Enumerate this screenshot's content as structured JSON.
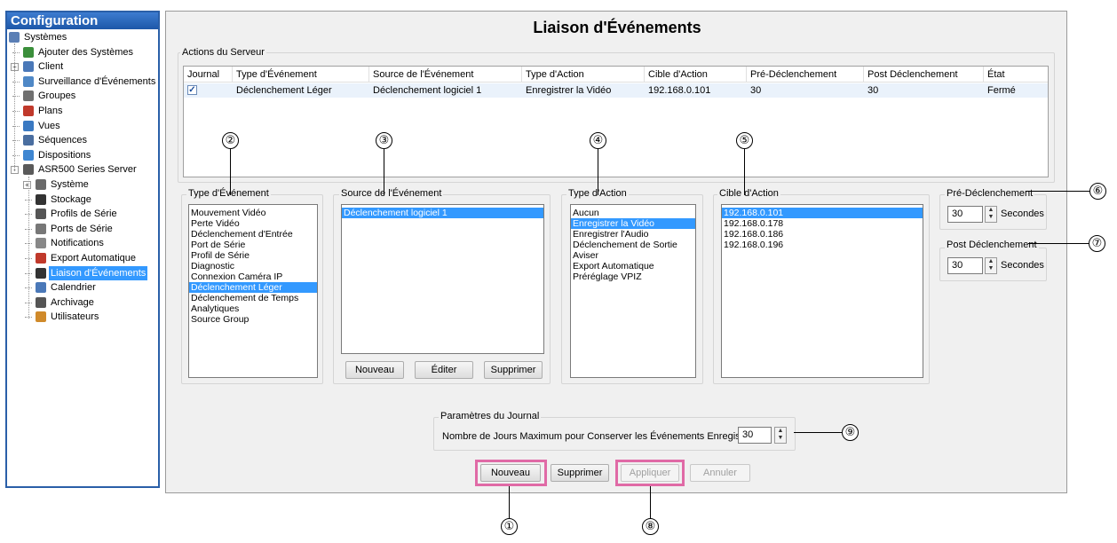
{
  "sidebar": {
    "title": "Configuration",
    "items": [
      {
        "label": "Systèmes",
        "icon": "systems-icon",
        "color": "#5b7fb5"
      },
      {
        "label": "Ajouter des Systèmes",
        "icon": "add-system-icon",
        "color": "#3b8f3b"
      },
      {
        "label": "Client",
        "icon": "client-icon",
        "color": "#4a78b8"
      },
      {
        "label": "Surveillance d'Événements",
        "icon": "event-monitor-icon",
        "color": "#4f88c6"
      },
      {
        "label": "Groupes",
        "icon": "groups-icon",
        "color": "#707070"
      },
      {
        "label": "Plans",
        "icon": "plans-icon",
        "color": "#c0392b"
      },
      {
        "label": "Vues",
        "icon": "views-icon",
        "color": "#3a79c2"
      },
      {
        "label": "Séquences",
        "icon": "sequences-icon",
        "color": "#4a6ea0"
      },
      {
        "label": "Dispositions",
        "icon": "layouts-icon",
        "color": "#3f86d1"
      },
      {
        "label": "ASR500 Series Server",
        "icon": "server-icon",
        "color": "#5a5a5a"
      },
      {
        "label": "Système",
        "icon": "system-icon",
        "color": "#6a6a6a"
      },
      {
        "label": "Stockage",
        "icon": "storage-icon",
        "color": "#333333"
      },
      {
        "label": "Profils de Série",
        "icon": "serial-profiles-icon",
        "color": "#555555"
      },
      {
        "label": "Ports de Série",
        "icon": "serial-ports-icon",
        "color": "#777777"
      },
      {
        "label": "Notifications",
        "icon": "notifications-icon",
        "color": "#888888"
      },
      {
        "label": "Export Automatique",
        "icon": "auto-export-icon",
        "color": "#c0392b"
      },
      {
        "label": "Liaison d'Événements",
        "icon": "event-link-icon",
        "color": "#333333"
      },
      {
        "label": "Calendrier",
        "icon": "calendar-icon",
        "color": "#4a78b8"
      },
      {
        "label": "Archivage",
        "icon": "archive-icon",
        "color": "#555555"
      },
      {
        "label": "Utilisateurs",
        "icon": "users-icon",
        "color": "#d08a2a"
      }
    ]
  },
  "main": {
    "title": "Liaison d'Événements",
    "server_actions": {
      "legend": "Actions du Serveur",
      "columns": [
        "Journal",
        "Type d'Événement",
        "Source de l'Événement",
        "Type d'Action",
        "Cible d'Action",
        "Pré-Déclenchement",
        "Post Déclenchement",
        "État"
      ],
      "rows": [
        {
          "journal": "✓",
          "event_type": "Déclenchement Léger",
          "event_source": "Déclenchement logiciel 1",
          "action_type": "Enregistrer la Vidéo",
          "action_target": "192.168.0.101",
          "pre": "30",
          "post": "30",
          "state": "Fermé"
        }
      ]
    },
    "event_type": {
      "legend": "Type d'Événement",
      "items": [
        "Mouvement Vidéo",
        "Perte Vidéo",
        "Déclenchement d'Entrée",
        "Port de Série",
        "Profil de Série",
        "Diagnostic",
        "Connexion Caméra IP",
        "Déclenchement Léger",
        "Déclenchement de Temps",
        "Analytiques",
        "Source Group"
      ],
      "selected": "Déclenchement Léger"
    },
    "event_source": {
      "legend": "Source de l'Événement",
      "items": [
        "Déclenchement logiciel 1"
      ],
      "selected": "Déclenchement logiciel 1",
      "new_label": "Nouveau",
      "edit_label": "Éditer",
      "delete_label": "Supprimer"
    },
    "action_type": {
      "legend": "Type d'Action",
      "items": [
        "Aucun",
        "Enregistrer la Vidéo",
        "Enregistrer l'Audio",
        "Déclenchement de Sortie",
        "Aviser",
        "Export Automatique",
        "Préréglage VPIZ"
      ],
      "selected": "Enregistrer la Vidéo"
    },
    "action_target": {
      "legend": "Cible d'Action",
      "items": [
        "192.168.0.101",
        "192.168.0.178",
        "192.168.0.186",
        "192.168.0.196"
      ],
      "selected": "192.168.0.101"
    },
    "pre_trigger": {
      "legend": "Pré-Déclenchement",
      "value": "30",
      "unit": "Secondes"
    },
    "post_trigger": {
      "legend": "Post Déclenchement",
      "value": "30",
      "unit": "Secondes"
    },
    "journal_params": {
      "legend": "Paramètres du Journal",
      "label": "Nombre de Jours Maximum pour Conserver les Événements Enregistrés:",
      "value": "30"
    },
    "buttons": {
      "new": "Nouveau",
      "delete": "Supprimer",
      "apply": "Appliquer",
      "cancel": "Annuler"
    }
  },
  "callouts": [
    "①",
    "②",
    "③",
    "④",
    "⑤",
    "⑥",
    "⑦",
    "⑧",
    "⑨"
  ],
  "colors": {
    "selection": "#3399ff",
    "highlight": "#e06aa6",
    "title_bar": "#2a5fa8"
  }
}
